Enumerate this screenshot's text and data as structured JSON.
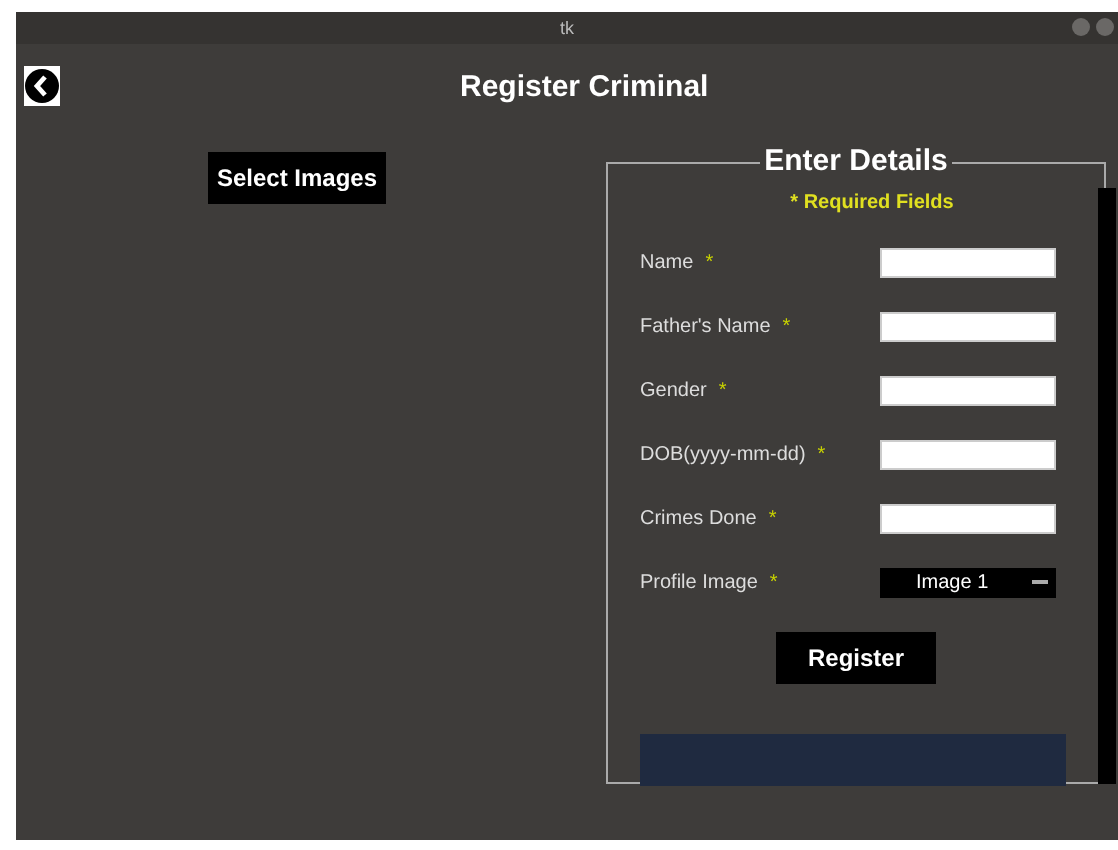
{
  "window": {
    "title": "tk"
  },
  "header": {
    "title": "Register Criminal"
  },
  "select_images_button": {
    "label": "Select Images"
  },
  "form": {
    "legend": "Enter Details",
    "required_note": "* Required Fields",
    "fields": [
      {
        "kind": "entry",
        "label": "Name",
        "required_mark": "*"
      },
      {
        "kind": "entry",
        "label": "Father's Name",
        "required_mark": "*"
      },
      {
        "kind": "entry",
        "label": "Gender",
        "required_mark": "*"
      },
      {
        "kind": "entry",
        "label": "DOB(yyyy-mm-dd)",
        "required_mark": "*"
      },
      {
        "kind": "entry",
        "label": "Crimes Done",
        "required_mark": "*"
      },
      {
        "kind": "option",
        "label": "Profile Image",
        "required_mark": "*",
        "value": "Image 1"
      }
    ],
    "register_button": {
      "label": "Register"
    }
  }
}
